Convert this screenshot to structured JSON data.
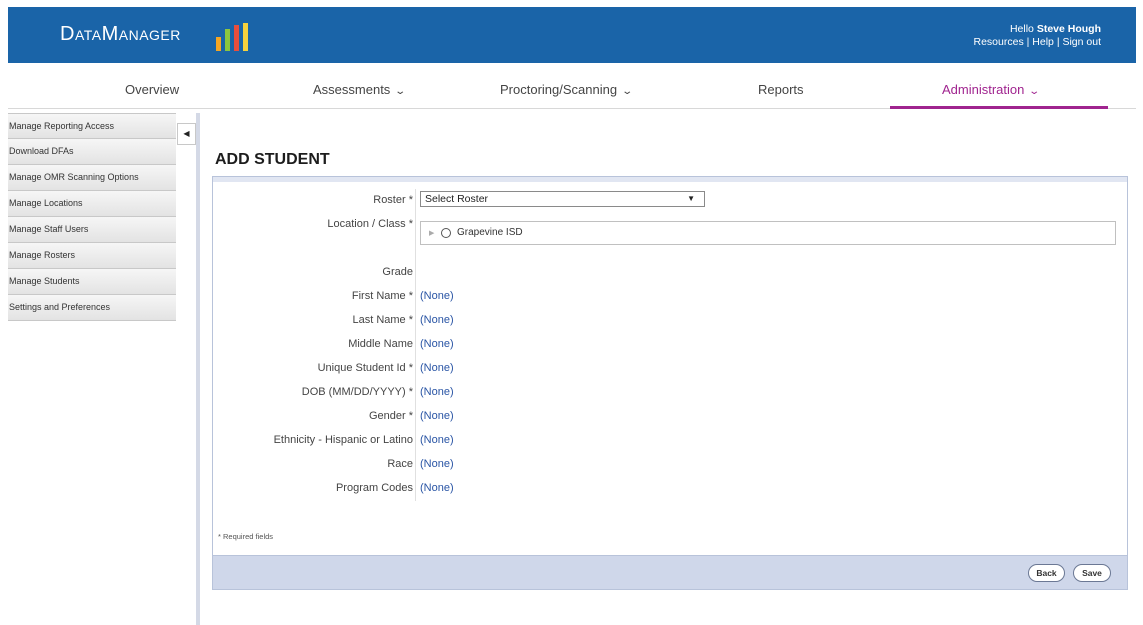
{
  "header": {
    "logo_text": "DataManager",
    "greeting_prefix": "Hello",
    "user_name": "Steve Hough",
    "links": [
      "Resources",
      "Help",
      "Sign out"
    ],
    "logo_bar_colors": [
      "#f5a623",
      "#8cc63f",
      "#e94e3d",
      "#f7d23e"
    ]
  },
  "nav": {
    "items": [
      {
        "label": "Overview"
      },
      {
        "label": "Assessments"
      },
      {
        "label": "Proctoring/Scanning"
      },
      {
        "label": "Reports"
      },
      {
        "label": "Administration"
      }
    ],
    "active_color": "#a0248f"
  },
  "sidebar": {
    "items": [
      {
        "label": "Manage Reporting Access"
      },
      {
        "label": "Download DFAs"
      },
      {
        "label": "Manage OMR Scanning Options"
      },
      {
        "label": "Manage Locations"
      },
      {
        "label": "Manage Staff Users"
      },
      {
        "label": "Manage Rosters"
      },
      {
        "label": "Manage Students"
      },
      {
        "label": "Settings and Preferences"
      }
    ]
  },
  "form": {
    "title": "ADD STUDENT",
    "roster": {
      "label": "Roster *",
      "selected": "Select Roster"
    },
    "location": {
      "label": "Location / Class *",
      "tree_root": "Grapevine ISD"
    },
    "fields": [
      {
        "label": "Grade",
        "value": ""
      },
      {
        "label": "First Name *",
        "value": "(None)"
      },
      {
        "label": "Last Name *",
        "value": "(None)"
      },
      {
        "label": "Middle Name",
        "value": "(None)"
      },
      {
        "label": "Unique Student Id *",
        "value": "(None)"
      },
      {
        "label": "DOB (MM/DD/YYYY) *",
        "value": "(None)"
      },
      {
        "label": "Gender *",
        "value": "(None)"
      },
      {
        "label": "Ethnicity - Hispanic or Latino",
        "value": "(None)"
      },
      {
        "label": "Race",
        "value": "(None)"
      },
      {
        "label": "Program Codes",
        "value": "(None)"
      }
    ],
    "required_note": "* Required fields",
    "buttons": {
      "back": "Back",
      "save": "Save"
    }
  }
}
